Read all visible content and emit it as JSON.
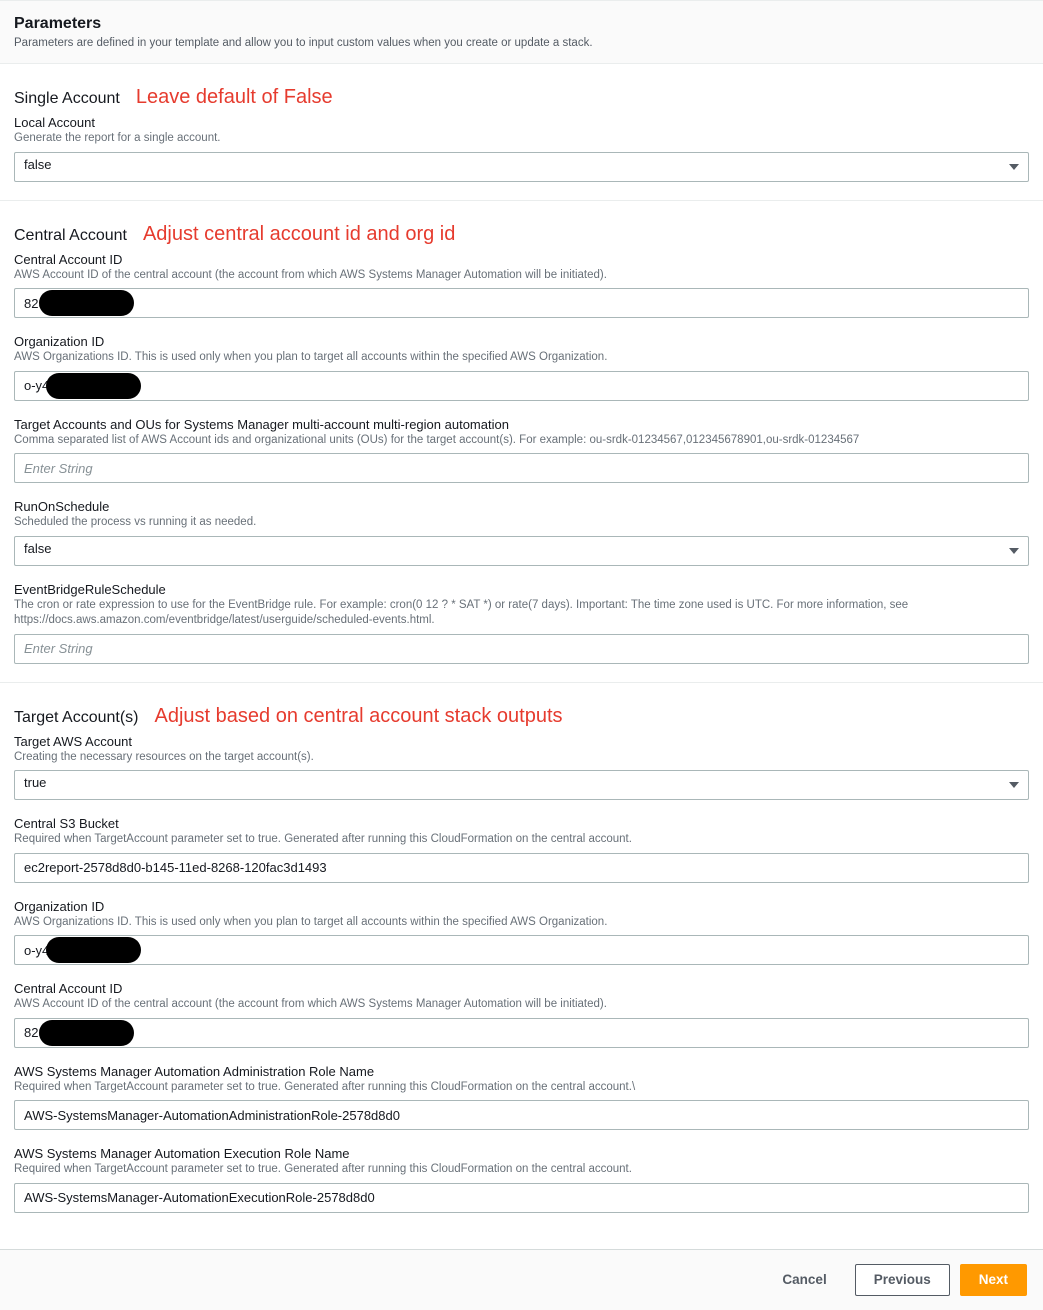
{
  "header": {
    "title": "Parameters",
    "desc": "Parameters are defined in your template and allow you to input custom values when you create or update a stack."
  },
  "annotations": {
    "single": "Leave default of False",
    "central": "Adjust central account id and org id",
    "target": "Adjust based on central account stack outputs"
  },
  "sections": {
    "single": {
      "title": "Single Account",
      "local_account": {
        "label": "Local Account",
        "hint": "Generate the report for a single account.",
        "value": "false"
      }
    },
    "central": {
      "title": "Central Account",
      "central_id": {
        "label": "Central Account ID",
        "hint": "AWS Account ID of the central account (the account from which AWS Systems Manager Automation will be initiated).",
        "value": "823"
      },
      "org_id": {
        "label": "Organization ID",
        "hint": "AWS Organizations ID. This is used only when you plan to target all accounts within the specified AWS Organization.",
        "value": "o-y4"
      },
      "targets": {
        "label": "Target Accounts and OUs for Systems Manager multi-account multi-region automation",
        "hint": "Comma separated list of AWS Account ids and organizational units (OUs) for the target account(s). For example: ou-srdk-01234567,012345678901,ou-srdk-01234567",
        "placeholder": "Enter String",
        "value": ""
      },
      "schedule": {
        "label": "RunOnSchedule",
        "hint": "Scheduled the process vs running it as needed.",
        "value": "false"
      },
      "rule": {
        "label": "EventBridgeRuleSchedule",
        "hint": "The cron or rate expression to use for the EventBridge rule. For example: cron(0 12 ? * SAT *) or rate(7 days). Important: The time zone used is UTC. For more information, see https://docs.aws.amazon.com/eventbridge/latest/userguide/scheduled-events.html.",
        "placeholder": "Enter String",
        "value": ""
      }
    },
    "target": {
      "title": "Target Account(s)",
      "target_aws": {
        "label": "Target AWS Account",
        "hint": "Creating the necessary resources on the target account(s).",
        "value": "true"
      },
      "s3": {
        "label": "Central S3 Bucket",
        "hint": "Required when TargetAccount parameter set to true. Generated after running this CloudFormation on the central account.",
        "value": "ec2report-2578d8d0-b145-11ed-8268-120fac3d1493"
      },
      "org_id": {
        "label": "Organization ID",
        "hint": "AWS Organizations ID. This is used only when you plan to target all accounts within the specified AWS Organization.",
        "value": "o-y4"
      },
      "central_id": {
        "label": "Central Account ID",
        "hint": "AWS Account ID of the central account (the account from which AWS Systems Manager Automation will be initiated).",
        "value": "823"
      },
      "admin_role": {
        "label": "AWS Systems Manager Automation Administration Role Name",
        "hint": "Required when TargetAccount parameter set to true. Generated after running this CloudFormation on the central account.\\",
        "value": "AWS-SystemsManager-AutomationAdministrationRole-2578d8d0"
      },
      "exec_role": {
        "label": "AWS Systems Manager Automation Execution Role Name",
        "hint": "Required when TargetAccount parameter set to true. Generated after running this CloudFormation on the central account.",
        "value": "AWS-SystemsManager-AutomationExecutionRole-2578d8d0"
      }
    }
  },
  "footer": {
    "cancel": "Cancel",
    "previous": "Previous",
    "next": "Next"
  }
}
